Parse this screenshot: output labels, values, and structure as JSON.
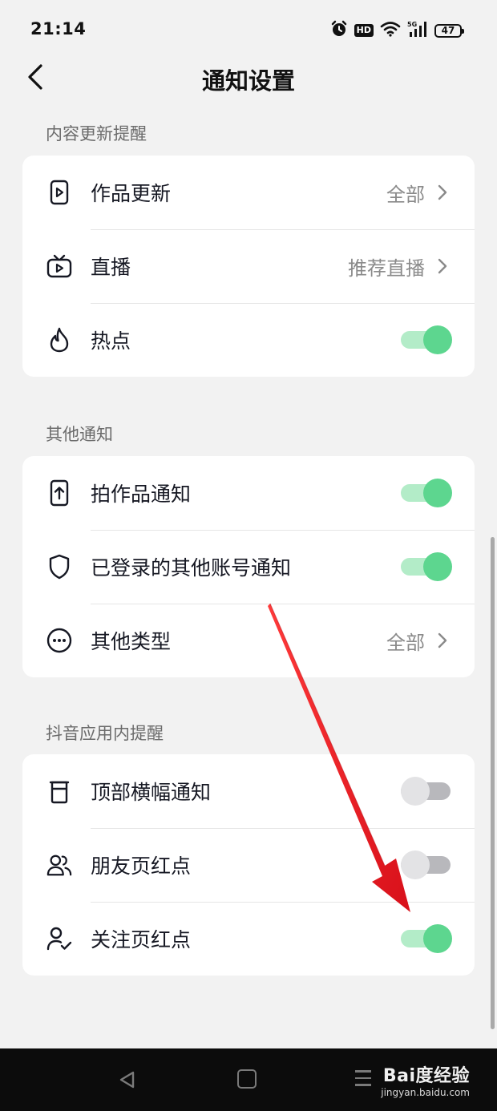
{
  "status_bar": {
    "time": "21:14",
    "hd": "HD",
    "battery": "47"
  },
  "header": {
    "title": "通知设置"
  },
  "sections": [
    {
      "title": "内容更新提醒",
      "items": [
        {
          "label": "作品更新",
          "value": "全部",
          "icon": "play-card-icon"
        },
        {
          "label": "直播",
          "value": "推荐直播",
          "icon": "tv-live-icon"
        },
        {
          "label": "热点",
          "icon": "flame-icon",
          "toggle": "on"
        }
      ]
    },
    {
      "title": "其他通知",
      "items": [
        {
          "label": "拍作品通知",
          "icon": "phone-upload-icon",
          "toggle": "on"
        },
        {
          "label": "已登录的其他账号通知",
          "icon": "shield-icon",
          "toggle": "on"
        },
        {
          "label": "其他类型",
          "value": "全部",
          "icon": "more-dots-icon"
        }
      ]
    },
    {
      "title": "抖音应用内提醒",
      "items": [
        {
          "label": "顶部横幅通知",
          "icon": "banner-icon",
          "toggle": "off"
        },
        {
          "label": "朋友页红点",
          "icon": "friends-icon",
          "toggle": "off"
        },
        {
          "label": "关注页红点",
          "icon": "user-check-icon",
          "toggle": "on"
        }
      ]
    }
  ],
  "colors": {
    "toggle_on": "#5dd68f",
    "toggle_on_track": "#b3ecc8",
    "toggle_off": "#b8b8bc",
    "arrow": "#e8141c"
  },
  "watermark": {
    "brand": "Bai度经验",
    "url": "jingyan.baidu.com"
  }
}
